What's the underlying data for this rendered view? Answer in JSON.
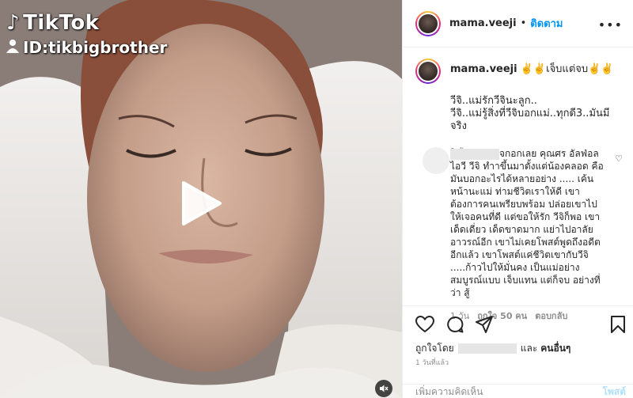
{
  "overlay": {
    "brand": "TikTok",
    "id_label": "ID:tikbigbrother"
  },
  "post": {
    "username": "mama.veeji",
    "follow_label": "ติดตาม",
    "caption_title": "✌️✌️เจ็บแต่จบ✌️✌️",
    "caption_line1": "วีจิ..แม่รักวีจินะลูก..",
    "caption_line2": "วีจิ..แม่รู้สิ่งที่วีจิบอกแม่..ทุกดี3..มันมีจริง",
    "caption_time": "1 วัน"
  },
  "comment": {
    "text": "จกอกเลย คุณศร อัลฟ่อล ไอวี วีจิ ทำาขึ้นมาตั้งแต่น้องคลอด คือมันบอกอะไรได้หลายอย่าง ..... เค้นหน้านะแม่ ท่ามชีวิตเราให้ดี เขาต้องการคนเพรียบพร้อม ปล่อยเขาไปให้เจอคนที่ดี แต่ขอให้รัก วีจิก็พอ เขาเด็ดเดี่ยว เด็ดขาดมาก แย่าไปอาลัยอาวรณ์อีก เขาไม่เคยโพสต์พูดถึงอดีตอีกแล้ว เขาโพสต์แค่ชีวิตเขากับวีจิ .....ก้าวไปให้มั่นคง เป็นแม่อย่างสมบูรณ์แบบ เจ็บแทน แต่ก็จบ อย่างที่ว่า สู้",
    "time": "1 วัน",
    "likes_label": "ถูกใจ 50 คน",
    "reply_label": "ตอบกลับ"
  },
  "actions": {
    "liked_by_prefix": "ถูกใจโดย",
    "liked_by_suffix": "และ",
    "others_label": "คนอื่นๆ",
    "date_label": "1 วันที่แล้ว",
    "add_comment_placeholder": "เพิ่มความคิดเห็น",
    "post_label": "โพสต์"
  },
  "colors": {
    "accent": "#0095f6",
    "post_disabled": "#b2dffc",
    "muted": "#8e8e8e"
  },
  "icons": [
    "tiktok-note-icon",
    "person-icon",
    "play-icon",
    "mute-icon",
    "more-icon",
    "heart-icon",
    "comment-icon",
    "share-icon",
    "bookmark-icon"
  ]
}
